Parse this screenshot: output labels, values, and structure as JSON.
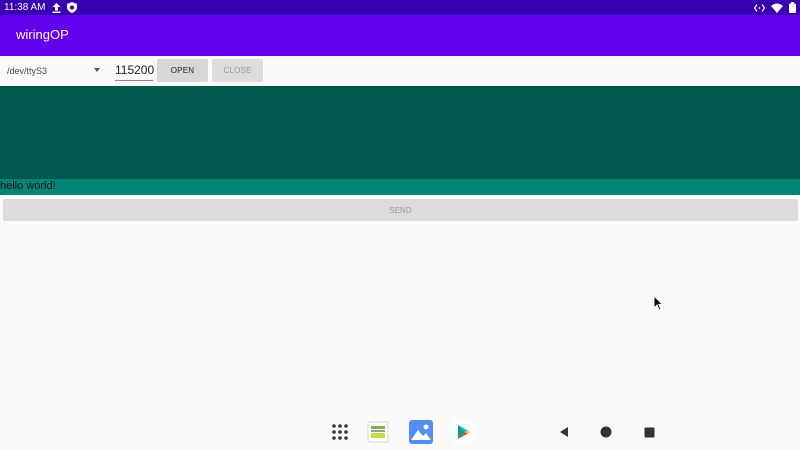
{
  "status_bar": {
    "time": "11:38 AM",
    "left_icons": [
      "upload-icon",
      "shield-icon"
    ],
    "right_icons": [
      "ethernet-icon",
      "wifi-icon",
      "battery-icon"
    ]
  },
  "app": {
    "title": "wiringOP"
  },
  "controls": {
    "port_selected": "/dev/ttyS3",
    "baud_rate": "115200",
    "open_label": "OPEN",
    "close_label": "CLOSE"
  },
  "colors": {
    "status_bar": "#3700b3",
    "app_bar": "#6200ee",
    "output_area": "#01594e",
    "input_bar": "#038577",
    "button": "#d6d7d7"
  },
  "input": {
    "text": "hello world!"
  },
  "send": {
    "label": "SEND"
  },
  "navigation": {
    "apps": [
      "apps-grid-icon",
      "gallery-app-icon",
      "photos-app-icon",
      "play-store-icon"
    ],
    "system": [
      "back-icon",
      "home-icon",
      "recents-icon"
    ]
  }
}
